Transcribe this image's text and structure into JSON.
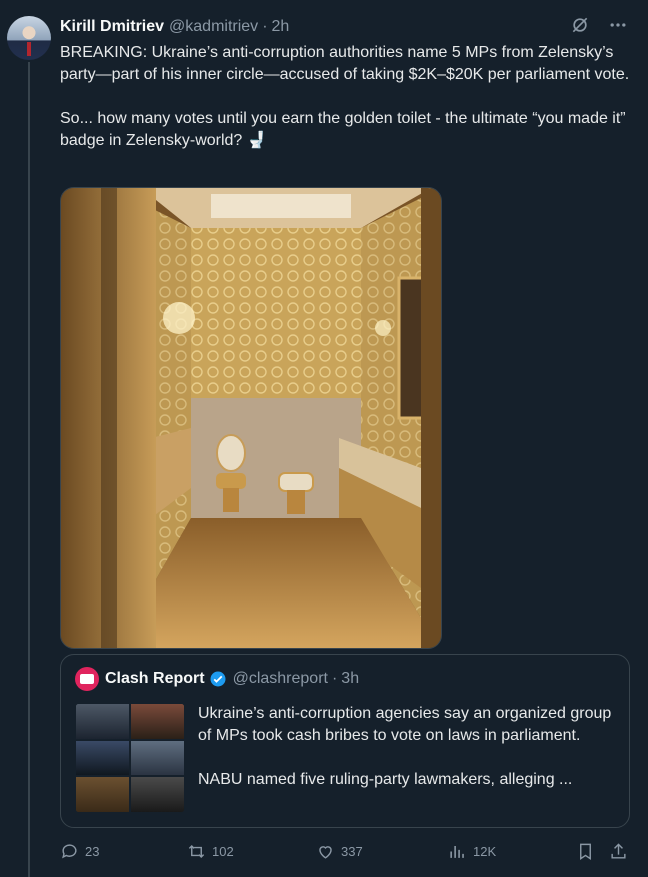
{
  "tweet": {
    "author_name": "Kirill Dmitriev",
    "author_handle": "@kadmitriev",
    "separator": "·",
    "time": "2h",
    "text": "BREAKING: Ukraine’s anti-corruption authorities name 5 MPs from Zelensky’s party—part of his inner circle—accused of taking $2K–$20K per parliament vote.\n\nSo... how many votes until you earn the golden toilet - the ultimate “you made it” badge in Zelensky-world? 🚽"
  },
  "quote": {
    "author_name": "Clash Report",
    "author_handle": "@clashreport",
    "separator": "·",
    "time": "3h",
    "text": "Ukraine’s anti-corruption agencies say an organized group of MPs took cash bribes to vote on laws in parliament.\n\nNABU named five ruling-party lawmakers, alleging ..."
  },
  "actions": {
    "replies": "23",
    "reposts": "102",
    "likes": "337",
    "views": "12K"
  },
  "colors": {
    "background": "#15202b",
    "muted": "#8b98a5",
    "border": "#38444d",
    "verified": "#1d9bf0",
    "gold": "#c9a45a"
  }
}
